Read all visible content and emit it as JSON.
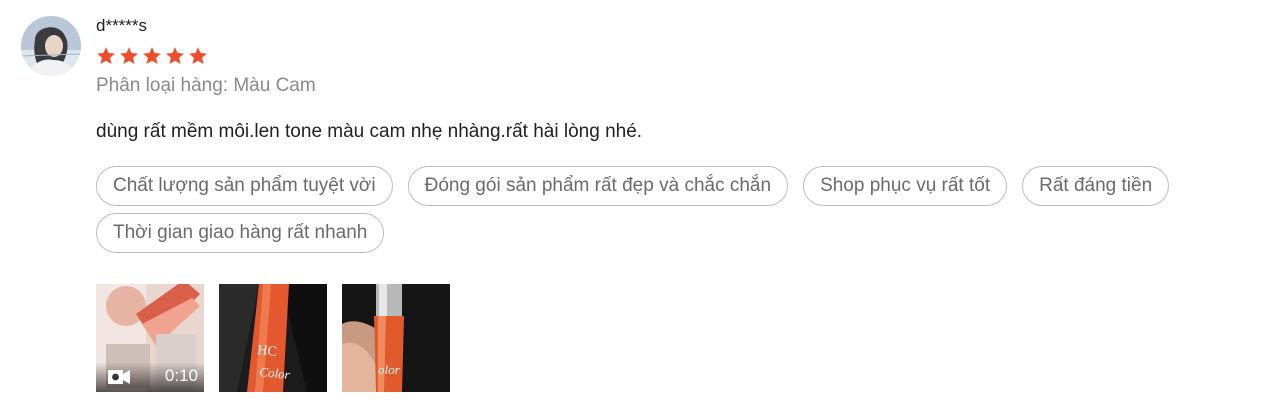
{
  "review": {
    "author": "d*****s",
    "rating": 5,
    "rating_color": "#ee4d2d",
    "variation": "Phân loại hàng: Màu Cam",
    "comment": "dùng rất mềm môi.len tone màu cam nhẹ nhàng.rất hài lòng nhé.",
    "tags": [
      "Chất lượng sản phẩm tuyệt vời",
      "Đóng gói sản phẩm rất đẹp và chắc chắn",
      "Shop phục vụ rất tốt",
      "Rất đáng tiền",
      "Thời gian giao hàng rất nhanh"
    ],
    "media": {
      "video": {
        "icon": "video-camera-icon",
        "duration": "0:10"
      },
      "photos": [
        {
          "icon": "photo-thumbnail"
        },
        {
          "icon": "photo-thumbnail"
        }
      ]
    }
  }
}
